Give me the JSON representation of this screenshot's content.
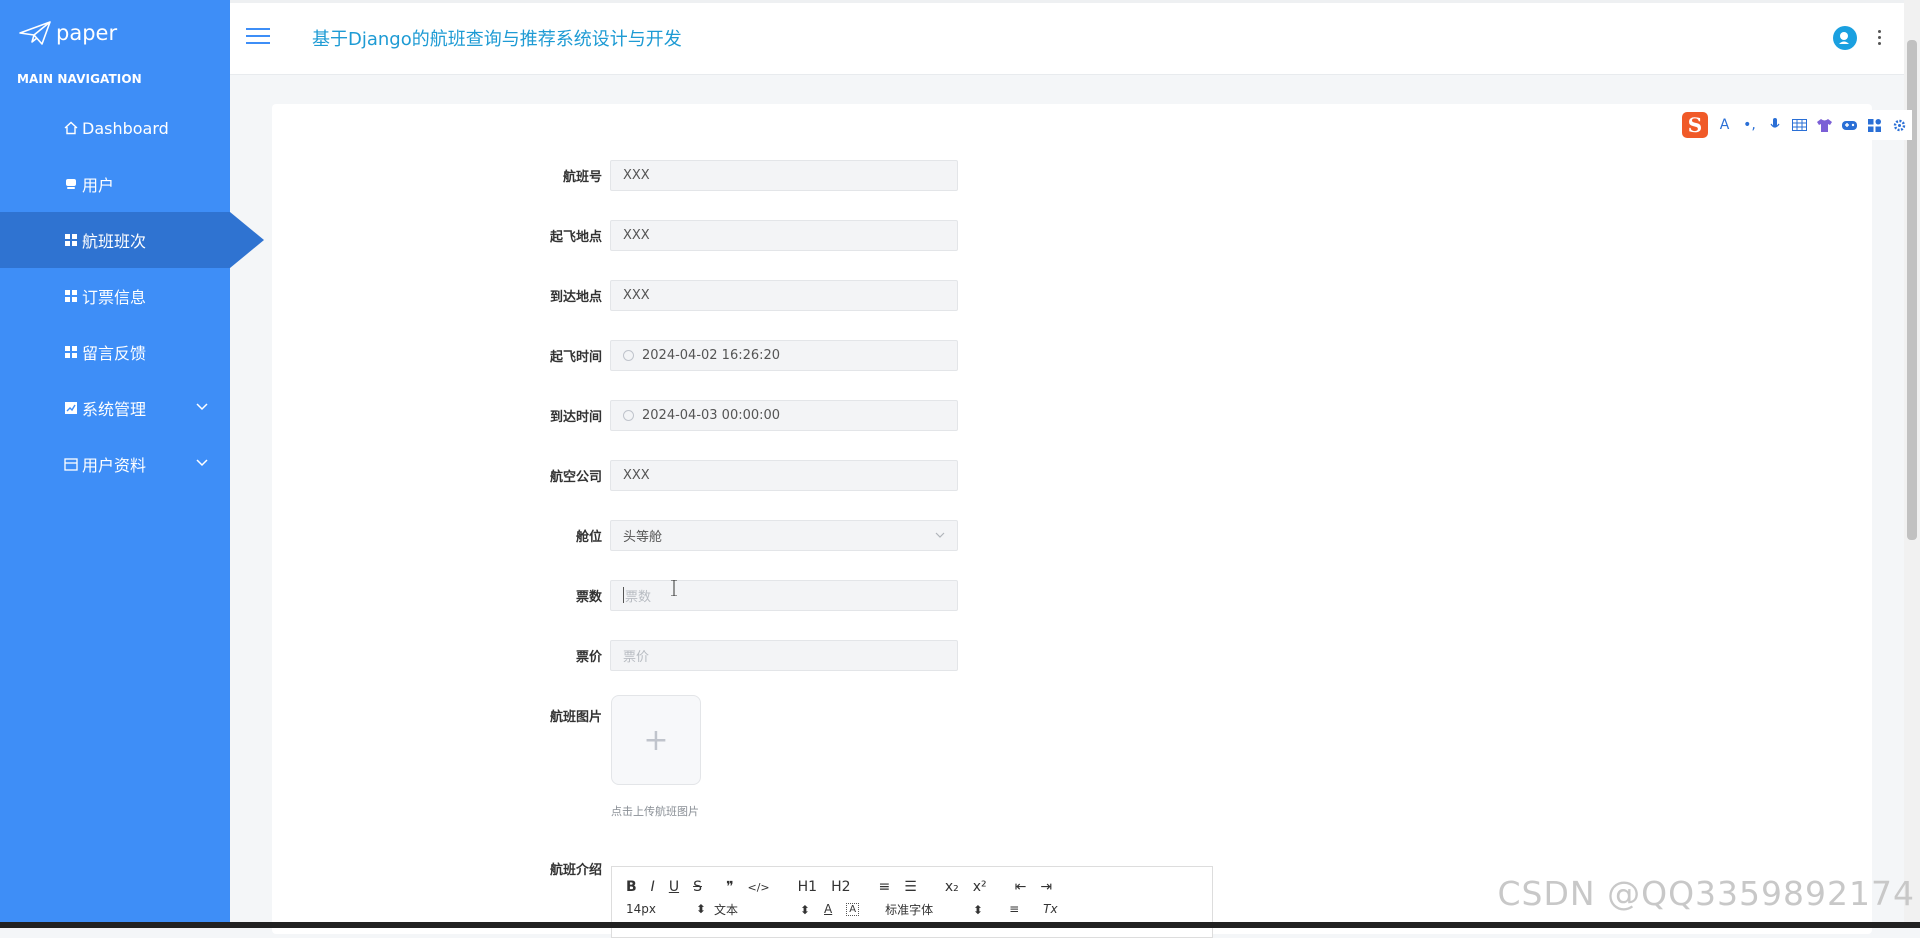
{
  "brand": {
    "logo_text": "paper"
  },
  "sidebar": {
    "section_title": "MAIN NAVIGATION",
    "items": [
      {
        "label": "Dashboard",
        "icon": "home-icon"
      },
      {
        "label": "用户",
        "icon": "user-icon"
      },
      {
        "label": "航班班次",
        "icon": "grid-icon",
        "active": true
      },
      {
        "label": "订票信息",
        "icon": "grid-icon"
      },
      {
        "label": "留言反馈",
        "icon": "grid-icon"
      },
      {
        "label": "系统管理",
        "icon": "chart-icon",
        "has_children": true
      },
      {
        "label": "用户资料",
        "icon": "card-icon",
        "has_children": true
      }
    ]
  },
  "header": {
    "title": "基于Django的航班查询与推荐系统设计与开发"
  },
  "form": {
    "flight_no": {
      "label": "航班号",
      "value": "XXX"
    },
    "departure_place": {
      "label": "起飞地点",
      "value": "XXX"
    },
    "arrival_place": {
      "label": "到达地点",
      "value": "XXX"
    },
    "departure_time": {
      "label": "起飞时间",
      "value": "2024-04-02 16:26:20"
    },
    "arrival_time": {
      "label": "到达时间",
      "value": "2024-04-03 00:00:00"
    },
    "airline": {
      "label": "航空公司",
      "value": "XXX"
    },
    "cabin": {
      "label": "舱位",
      "value": "头等舱"
    },
    "ticket_count": {
      "label": "票数",
      "placeholder": "票数"
    },
    "ticket_price": {
      "label": "票价",
      "placeholder": "票价"
    },
    "flight_image": {
      "label": "航班图片",
      "upload_symbol": "+",
      "tip": "点击上传航班图片"
    },
    "flight_intro": {
      "label": "航班介绍",
      "toolbar_row1": [
        "B",
        "I",
        "U",
        "S",
        "❞",
        "</>",
        "H1",
        "H2",
        "≡",
        "☰",
        "x₂",
        "x²",
        "⇤",
        "⇥"
      ],
      "toolbar_row2": {
        "font_size": "14px",
        "format": "文本",
        "font_family": "标准字体",
        "color_a": "A",
        "bg_a": "A",
        "align": "≡",
        "clear": "Tx"
      }
    }
  },
  "watermark": "CSDN @QQ3359892174"
}
